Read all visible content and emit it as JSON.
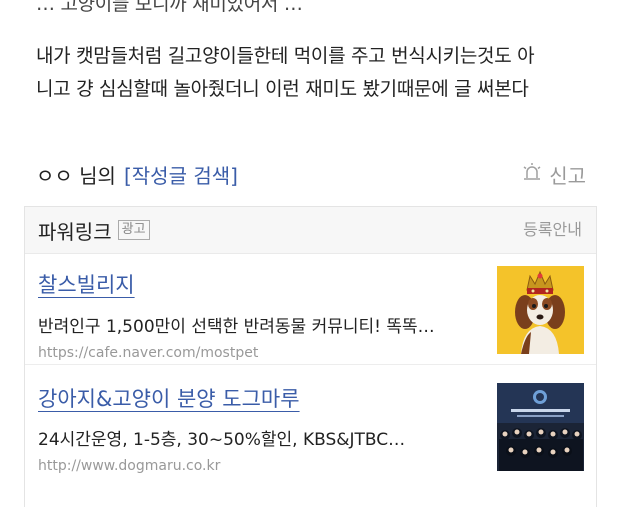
{
  "post": {
    "line_partial": "… 고양이들 보니까 재미있어서 …",
    "paragraph_1": "내가 캣맘들처럼 길고양이들한테 먹이를 주고 번식시키는것도 아",
    "paragraph_2": "니고 걍 심심할때 놀아줬더니 이런 재미도 봤기때문에 글 써본다"
  },
  "author": {
    "name": "ㅇㅇ 님의",
    "search_link": "[작성글 검색]",
    "report_label": "신고"
  },
  "powerlink": {
    "title": "파워링크",
    "ad_badge": "광고",
    "register_label": "등록안내",
    "ads": [
      {
        "title": "찰스빌리지",
        "description": "반려인구 1,500만이 선택한 반려동물 커뮤니티! 똑똑…",
        "url": "https://cafe.naver.com/mostpet",
        "image": "dog-with-crown-image"
      },
      {
        "title": "강아지&고양이 분양 도그마루",
        "description": "24시간운영, 1-5층, 30~50%할인, KBS&JTBC…",
        "url": "http://www.dogmaru.co.kr",
        "image": "group-photo-image"
      }
    ]
  },
  "colors": {
    "link": "#3a5ca8",
    "muted": "#9a9a9a",
    "header_bg": "#f7f7f7"
  }
}
